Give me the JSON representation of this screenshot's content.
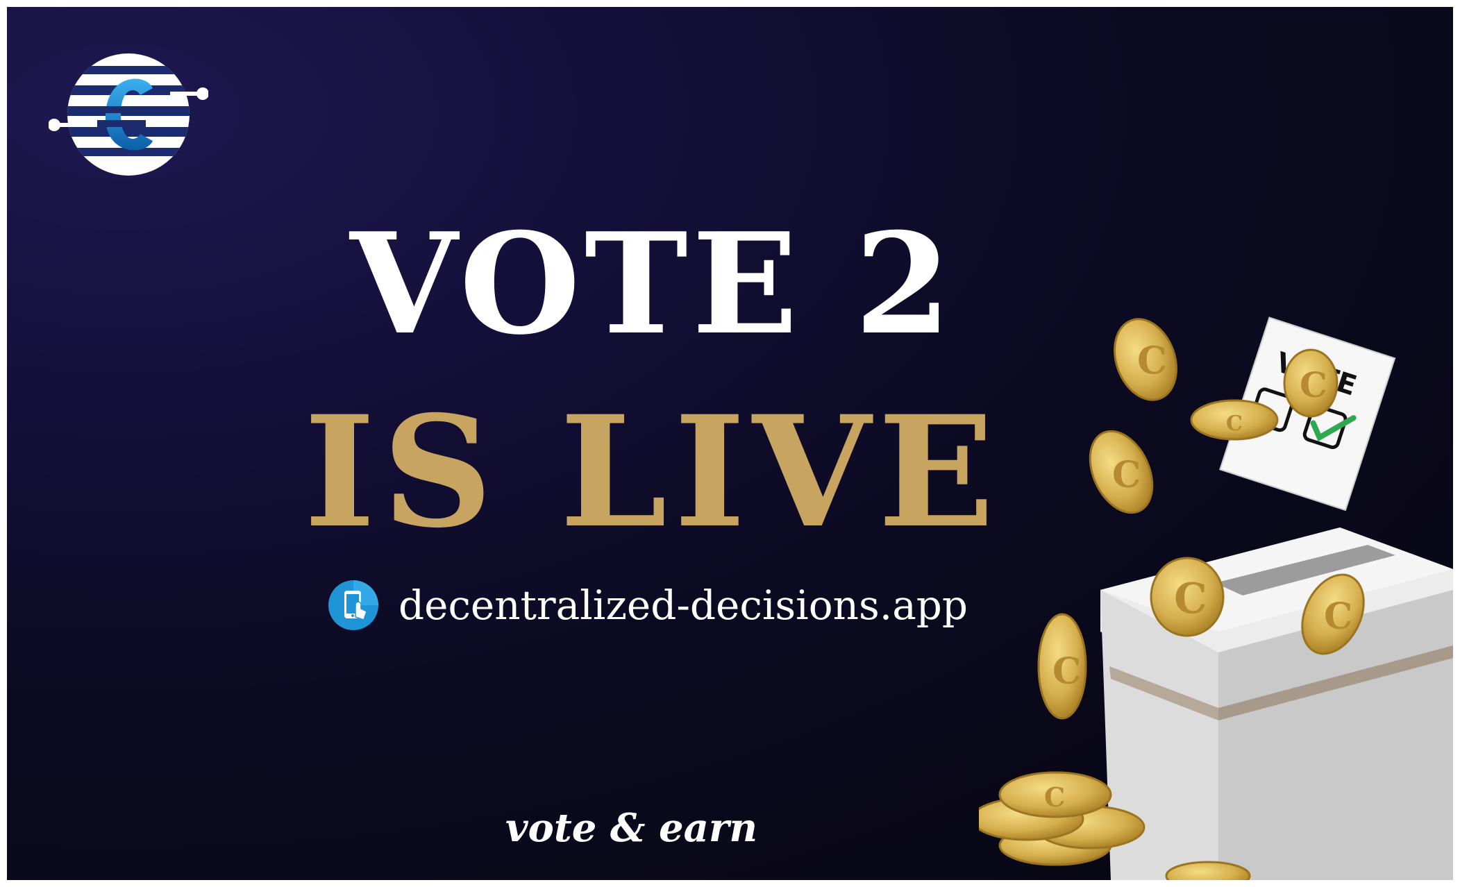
{
  "headline": {
    "line1": "VOTE 2",
    "line2": "IS LIVE"
  },
  "link": {
    "icon": "tap-phone-icon",
    "url": "decentralized-decisions.app"
  },
  "tagline": "vote & earn",
  "ballot": {
    "label": "VOTE"
  },
  "colors": {
    "background_dark": "#07070f",
    "background_glow": "#1d1850",
    "gold": "#c7a45f",
    "white": "#ffffff",
    "logo_blue": "#1e90d6",
    "check_green": "#2fa84f"
  }
}
